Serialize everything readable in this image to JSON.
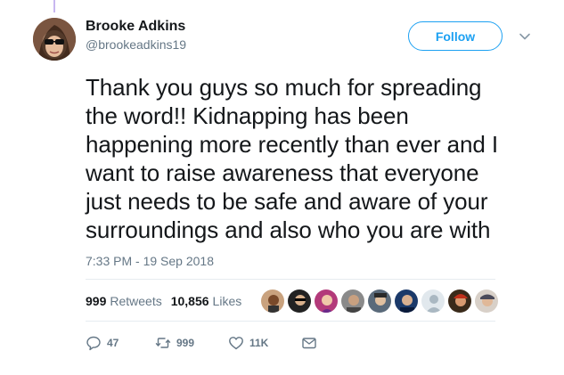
{
  "tweet": {
    "author_name": "Brooke Adkins",
    "author_handle": "@brookeadkins19",
    "follow_label": "Follow",
    "text_lines": [
      "Thank you guys so much for spreading",
      "the word!! Kidnapping has been",
      "happening more recently than ever and I",
      "want to raise awareness that everyone",
      "just needs to be safe and aware of your",
      "surroundings and also who you are with"
    ],
    "timestamp": "7:33 PM - 19 Sep 2018",
    "stats": {
      "retweets_count": "999",
      "retweets_label": "Retweets",
      "likes_count": "10,856",
      "likes_label": "Likes"
    },
    "actions": {
      "reply_count": "47",
      "retweet_count": "999",
      "like_count": "11K"
    }
  },
  "colors": {
    "accent": "#1da1f2",
    "text": "#14171a",
    "muted": "#657786"
  },
  "icons": {
    "reply": "reply-icon",
    "retweet": "retweet-icon",
    "like": "heart-icon",
    "dm": "envelope-icon",
    "more": "chevron-down-icon"
  }
}
